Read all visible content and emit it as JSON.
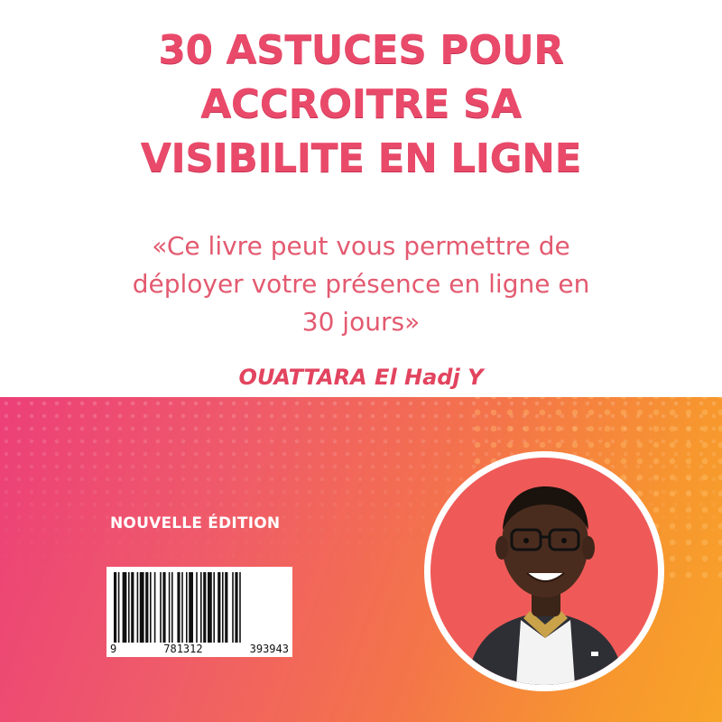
{
  "cover": {
    "title_lines": [
      "30 ASTUCES POUR",
      "ACCROITRE SA",
      "VISIBILITE EN LIGNE"
    ],
    "quote_lines": [
      "«Ce livre peut vous permettre de",
      "déployer votre présence en ligne en",
      "30 jours»"
    ],
    "author": "OUATTARA El Hadj Y",
    "edition": "NOUVELLE ÉDITION",
    "barcode": {
      "lead_digit": "9",
      "group_1": "781312",
      "group_2": "393943"
    },
    "photo_subject": "author portrait",
    "colors": {
      "title": "#ea4a6a",
      "quote": "#e35a70",
      "gradient_start": "#ec3f78",
      "gradient_end": "#f8a429",
      "photo_background": "#ef5a58"
    }
  }
}
